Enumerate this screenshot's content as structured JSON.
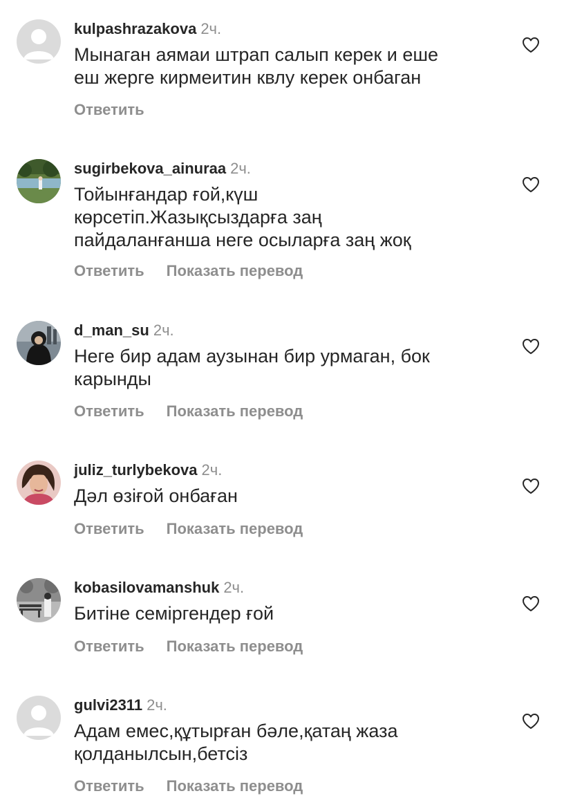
{
  "comments": [
    {
      "username": "kulpashrazakova",
      "time": "2ч.",
      "text_lines": [
        "Мынаган аямаи штрап салып керек и еше",
        "еш жерге кирмеитин квлу керек онбаган"
      ],
      "reply_label": "Ответить",
      "avatar": "default-avatar-icon"
    },
    {
      "username": "sugirbekova_ainuraa",
      "time": "2ч.",
      "text_lines": [
        "Тойынғандар ғой,күш",
        "көрсетіп.Жазықсыздарға заң",
        "пайдаланғанша неге осыларға заң жоқ"
      ],
      "reply_label": "Ответить",
      "translate_label": "Показать перевод",
      "avatar": "nature-photo-avatar"
    },
    {
      "username": "d_man_su",
      "time": "2ч.",
      "text_lines": [
        "Неге бир адам аузынан бир урмаган, бок",
        "карынды"
      ],
      "reply_label": "Ответить",
      "translate_label": "Показать перевод",
      "avatar": "hooded-person-avatar"
    },
    {
      "username": "juliz_turlybekova",
      "time": "2ч.",
      "text_lines": [
        "Дәл өзіғой онбаған"
      ],
      "reply_label": "Ответить",
      "translate_label": "Показать перевод",
      "avatar": "woman-portrait-avatar"
    },
    {
      "username": "kobasilovamanshuk",
      "time": "2ч.",
      "text_lines": [
        "Битіне семіргендер ғой"
      ],
      "reply_label": "Ответить",
      "translate_label": "Показать перевод",
      "avatar": "bench-photo-avatar"
    },
    {
      "username": "gulvi2311",
      "time": "2ч.",
      "text_lines": [
        "Адам емес,құтырған бәле,қатаң жаза",
        "қолданылсын,бетсіз"
      ],
      "reply_label": "Ответить",
      "translate_label": "Показать перевод",
      "avatar": "default-avatar-icon"
    }
  ],
  "colors": {
    "text": "#262626",
    "secondary": "#8e8e8e",
    "heart_outline": "#262626",
    "default_avatar_bg": "#dbdbdb"
  }
}
